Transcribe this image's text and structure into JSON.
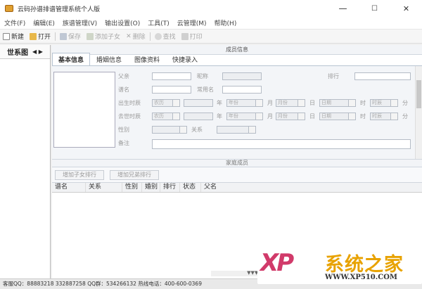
{
  "window": {
    "title": "云码孙谱排谱管理系统个人版",
    "min": "—",
    "max": "☐",
    "close": "✕"
  },
  "menu": [
    "文件(F)",
    "编辑(E)",
    "族谱管理(V)",
    "输出设置(O)",
    "工具(T)",
    "云管理(M)",
    "帮助(H)"
  ],
  "toolbar": {
    "new": "新建",
    "open": "打开",
    "save": "保存",
    "add_child": "添加子女",
    "delete": "删除",
    "search": "查找",
    "print": "打印"
  },
  "left": {
    "title": "世系图",
    "arrows": "◀ ▶"
  },
  "main": {
    "section_title": "成员信息",
    "tabs": [
      "基本信息",
      "婚姻信息",
      "图像资料",
      "快捷录入"
    ],
    "form": {
      "surname": "父亲",
      "alias": "昵称",
      "rank": "排行",
      "name": "谱名",
      "common_name": "常用名",
      "birth_date": "出生时辰",
      "death_date": "去世时辰",
      "dd_calendar": "农历",
      "dd_year": "年份",
      "dd_month": "月份",
      "dd_day": "日期",
      "dd_hour": "时辰",
      "year": "年",
      "month": "月",
      "day": "日",
      "hour": "时",
      "minute": "分",
      "gender": "性别",
      "relation": "关系",
      "remark": "备注"
    },
    "addr_title": "家庭成员",
    "btn_add_child": "增加子女排行",
    "btn_add_spouse": "增加兄弟排行",
    "grid_headers": [
      "谱名",
      "关系",
      "性别",
      "婚别",
      "排行",
      "状态",
      "父名"
    ]
  },
  "statusbar": "客服QQ：88883218  332887258  QQ群：534266132    热线电话：400-600-0369",
  "watermark": {
    "xp": "XP",
    "name": "系统之家",
    "url": "WWW.XP510.COM"
  }
}
